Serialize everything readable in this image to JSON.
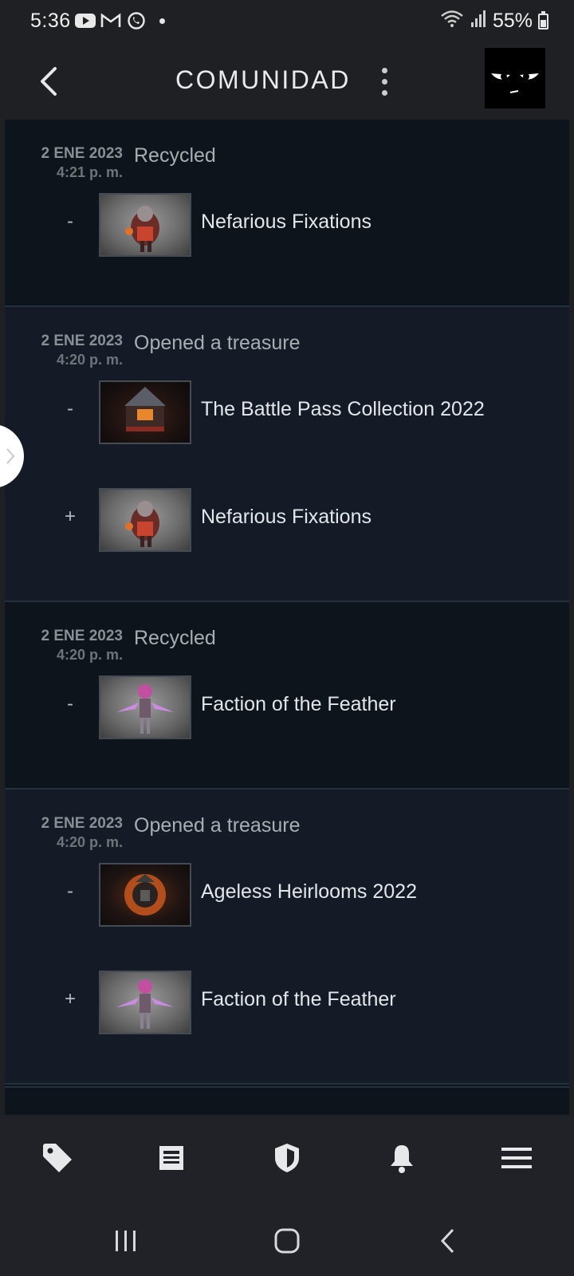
{
  "status_bar": {
    "time": "5:36",
    "battery": "55%",
    "icons": [
      "youtube-icon",
      "gmail-icon",
      "whatsapp-icon",
      "notification-dot",
      "wifi-icon",
      "signal-icon",
      "battery-icon"
    ]
  },
  "app_bar": {
    "title": "COMUNIDAD",
    "back_icon": "back-arrow-icon",
    "menu_icon": "more-vert-icon",
    "avatar_icon": "angry-eyes-avatar"
  },
  "feed": {
    "entries": [
      {
        "date": "2 ENE 2023",
        "time": "4:21 p. m.",
        "action": "Recycled",
        "items": [
          {
            "sign": "-",
            "name": "Nefarious Fixations"
          }
        ]
      },
      {
        "date": "2 ENE 2023",
        "time": "4:20 p. m.",
        "action": "Opened a treasure",
        "items": [
          {
            "sign": "-",
            "name": "The Battle Pass Collection 2022"
          },
          {
            "sign": "+",
            "name": "Nefarious Fixations"
          }
        ]
      },
      {
        "date": "2 ENE 2023",
        "time": "4:20 p. m.",
        "action": "Recycled",
        "items": [
          {
            "sign": "-",
            "name": "Faction of the Feather"
          }
        ]
      },
      {
        "date": "2 ENE 2023",
        "time": "4:20 p. m.",
        "action": "Opened a treasure",
        "items": [
          {
            "sign": "-",
            "name": "Ageless Heirlooms 2022"
          },
          {
            "sign": "+",
            "name": "Faction of the Feather"
          }
        ]
      }
    ]
  },
  "bottom_nav": {
    "items": [
      "tag-icon",
      "news-icon",
      "shield-icon",
      "bell-icon",
      "hamburger-menu-icon"
    ]
  },
  "system_nav": {
    "items": [
      "recent-apps-icon",
      "home-icon",
      "system-back-icon"
    ]
  },
  "colors": {
    "background": "#1f2024",
    "feed_dark": "#0e141b",
    "feed_light": "#141b26",
    "text_primary": "#e3e6ea",
    "text_muted": "#8a8f96"
  }
}
